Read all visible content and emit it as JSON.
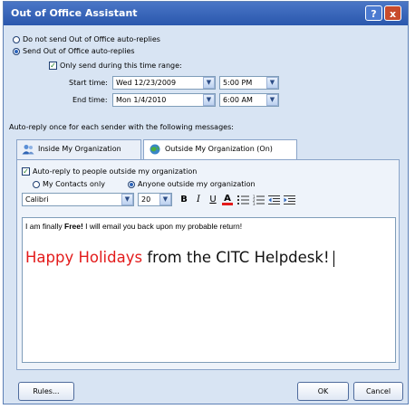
{
  "window": {
    "title": "Out of Office Assistant",
    "help_icon": "?",
    "close_icon": "x"
  },
  "options": {
    "do_not_send": "Do not send Out of Office auto-replies",
    "send": "Send Out of Office auto-replies",
    "only_send_range": "Only send during this time range:",
    "selected": "send"
  },
  "time_range": {
    "start_label": "Start time:",
    "start_date": "Wed 12/23/2009",
    "start_time": "5:00 PM",
    "end_label": "End time:",
    "end_date": "Mon 1/4/2010",
    "end_time": "6:00 AM"
  },
  "autoreply_caption": "Auto-reply once for each sender with the following messages:",
  "tabs": [
    {
      "label": "Inside My Organization",
      "icon": "people-icon"
    },
    {
      "label": "Outside My Organization (On)",
      "icon": "globe-icon"
    }
  ],
  "outside": {
    "autoreply_checkbox": "Auto-reply to people outside my organization",
    "my_contacts_only": "My Contacts only",
    "anyone_outside": "Anyone outside my organization"
  },
  "format": {
    "font": "Calibri",
    "size": "20",
    "bold": "B",
    "italic": "I",
    "underline": "U",
    "font_color": "A"
  },
  "message": {
    "line1_before": "I am finally ",
    "line1_bold": "Free!",
    "line1_after": "  I will email you back upon my probable return!",
    "line2_red": "Happy Holidays",
    "line2_rest": " from the CITC Helpdesk!",
    "red_color": "#e31b1b"
  },
  "buttons": {
    "rules": "Rules...",
    "ok": "OK",
    "cancel": "Cancel"
  }
}
